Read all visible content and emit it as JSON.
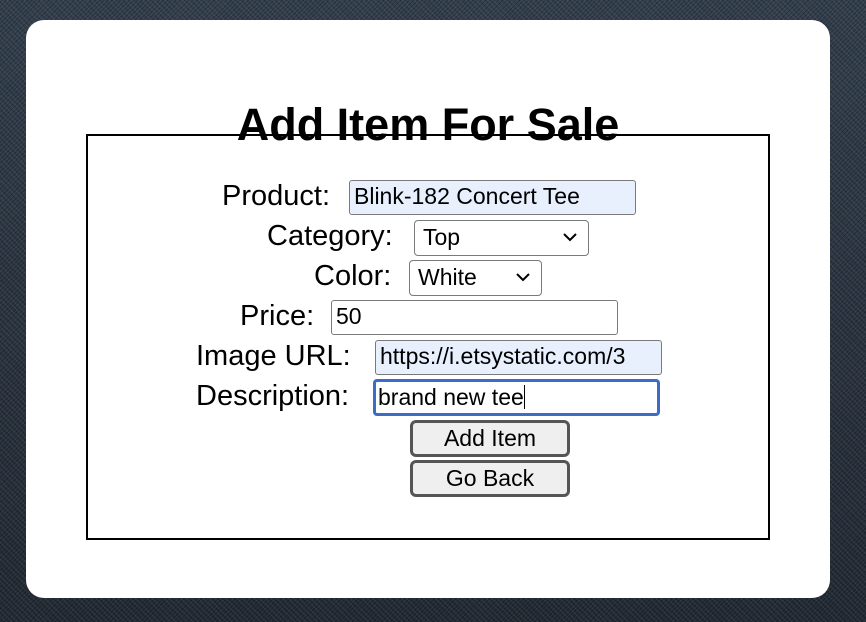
{
  "page": {
    "title": "Add Item For Sale"
  },
  "form": {
    "product": {
      "label": "Product:",
      "value": "Blink-182 Concert Tee"
    },
    "category": {
      "label": "Category:",
      "selected": "Top"
    },
    "color": {
      "label": "Color:",
      "selected": "White"
    },
    "price": {
      "label": "Price:",
      "value": "50"
    },
    "image_url": {
      "label": "Image URL:",
      "value": "https://i.etsystatic.com/3"
    },
    "description": {
      "label": "Description:",
      "value": "brand new tee"
    },
    "add_item_label": "Add Item",
    "go_back_label": "Go Back"
  },
  "colors": {
    "autofill_bg": "#e8f0fe",
    "focus_border": "#3c6cc5"
  }
}
